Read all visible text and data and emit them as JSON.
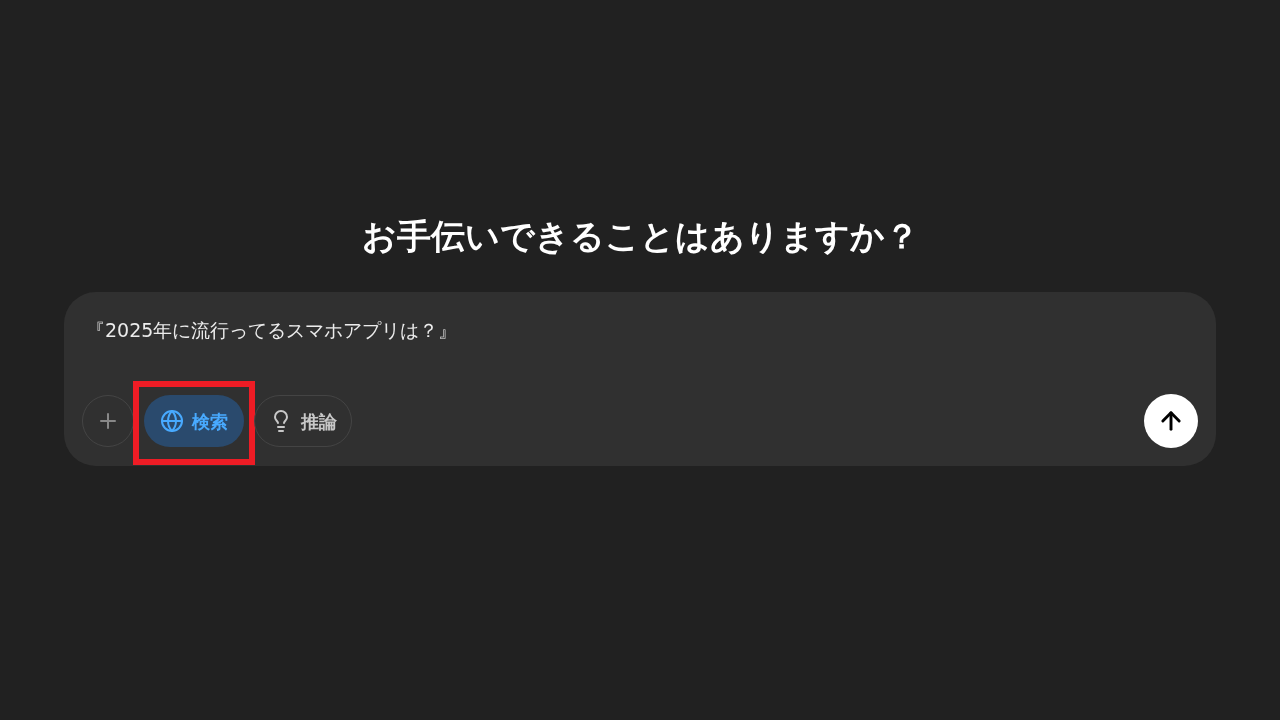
{
  "heading": "お手伝いできることはありますか？",
  "composer": {
    "value": "『2025年に流行ってるスマホアプリは？』",
    "tools": [
      {
        "kind": "globe",
        "label": "検索",
        "selected": true,
        "highlighted": true
      },
      {
        "kind": "bulb",
        "label": "推論",
        "selected": false,
        "highlighted": false
      }
    ]
  }
}
